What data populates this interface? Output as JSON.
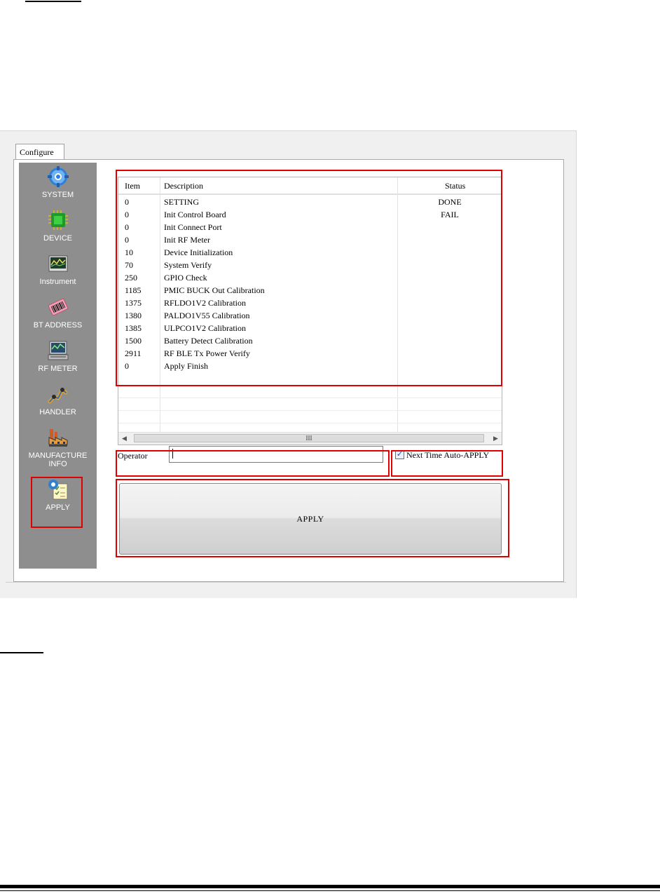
{
  "window": {
    "tab_label": "Configure"
  },
  "sidebar": {
    "items": [
      {
        "label": "SYSTEM",
        "icon": "gear-icon"
      },
      {
        "label": "DEVICE",
        "icon": "chip-icon"
      },
      {
        "label": "Instrument",
        "icon": "instrument-icon"
      },
      {
        "label": "BT ADDRESS",
        "icon": "barcode-icon"
      },
      {
        "label": "RF METER",
        "icon": "rf-meter-icon"
      },
      {
        "label": "HANDLER",
        "icon": "robot-arm-icon"
      },
      {
        "label": "MANUFACTURE\nINFO",
        "icon": "factory-icon"
      },
      {
        "label": "APPLY",
        "icon": "apply-icon"
      }
    ],
    "selected": "APPLY"
  },
  "table": {
    "columns": [
      "Item",
      "Description",
      "Status"
    ],
    "rows": [
      {
        "item": "0",
        "description": "SETTING",
        "status": "DONE"
      },
      {
        "item": "0",
        "description": "Init Control Board",
        "status": "FAIL"
      },
      {
        "item": "0",
        "description": "Init Connect Port",
        "status": ""
      },
      {
        "item": "0",
        "description": "Init RF Meter",
        "status": ""
      },
      {
        "item": "10",
        "description": "Device Initialization",
        "status": ""
      },
      {
        "item": "70",
        "description": "System Verify",
        "status": ""
      },
      {
        "item": "250",
        "description": "GPIO Check",
        "status": ""
      },
      {
        "item": "1185",
        "description": "PMIC BUCK Out Calibration",
        "status": ""
      },
      {
        "item": "1375",
        "description": "RFLDO1V2 Calibration",
        "status": ""
      },
      {
        "item": "1380",
        "description": "PALDO1V55 Calibration",
        "status": ""
      },
      {
        "item": "1385",
        "description": "ULPCO1V2 Calibration",
        "status": ""
      },
      {
        "item": "1500",
        "description": "Battery Detect Calibration",
        "status": ""
      },
      {
        "item": "2911",
        "description": "RF BLE Tx Power Verify",
        "status": ""
      },
      {
        "item": "0",
        "description": "Apply Finish",
        "status": ""
      }
    ],
    "scroll_thumb_label": "III"
  },
  "operator": {
    "label": "Operator",
    "value": ""
  },
  "auto_apply": {
    "label": "Next Time Auto-APPLY",
    "checked": true
  },
  "apply_button": {
    "label": "APPLY"
  },
  "colors": {
    "highlight": "#e00000",
    "sidebar_bg": "#8e8e8e"
  }
}
